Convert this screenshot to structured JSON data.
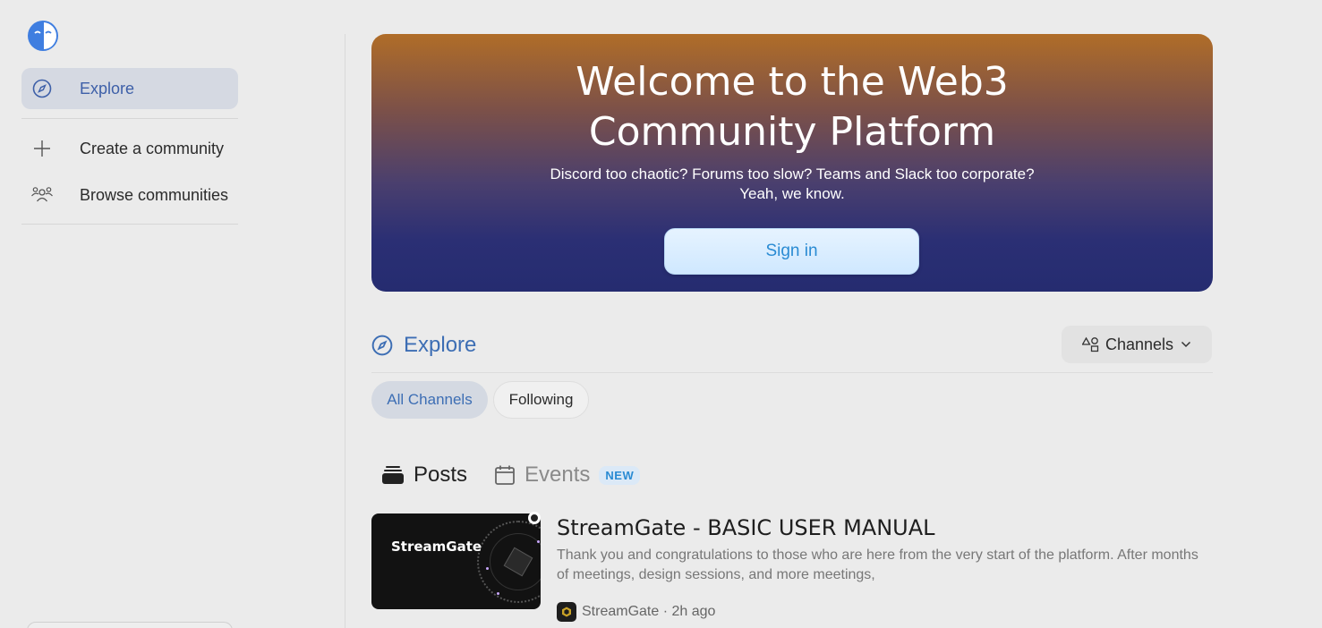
{
  "sidebar": {
    "items": [
      {
        "label": "Explore",
        "icon": "compass-icon",
        "active": true
      },
      {
        "label": "Create a community",
        "icon": "plus-icon"
      },
      {
        "label": "Browse communities",
        "icon": "people-icon"
      }
    ]
  },
  "hero": {
    "title": "Welcome to the Web3 Community Platform",
    "subtitle_line1": "Discord too chaotic? Forums too slow? Teams and Slack too corporate?",
    "subtitle_line2": "Yeah, we know.",
    "signin_label": "Sign in"
  },
  "explore": {
    "heading": "Explore",
    "channels_button": "Channels",
    "chips": [
      "All Channels",
      "Following"
    ],
    "tabs": {
      "posts": "Posts",
      "events": "Events",
      "new_badge": "NEW"
    }
  },
  "post": {
    "thumb_brand": "StreamGate",
    "title": "StreamGate - BASIC USER MANUAL",
    "excerpt": "Thank you and congratulations to those who are here from the very start of the platform. After months of meetings, design sessions, and more meetings,",
    "channel": "StreamGate",
    "time": "2h ago"
  },
  "colors": {
    "accent": "#3d6eb4",
    "active_bg": "#d5d9e2",
    "hero_top": "#b06d28",
    "hero_bottom": "#252c70",
    "signin_text": "#2a8bd3"
  }
}
